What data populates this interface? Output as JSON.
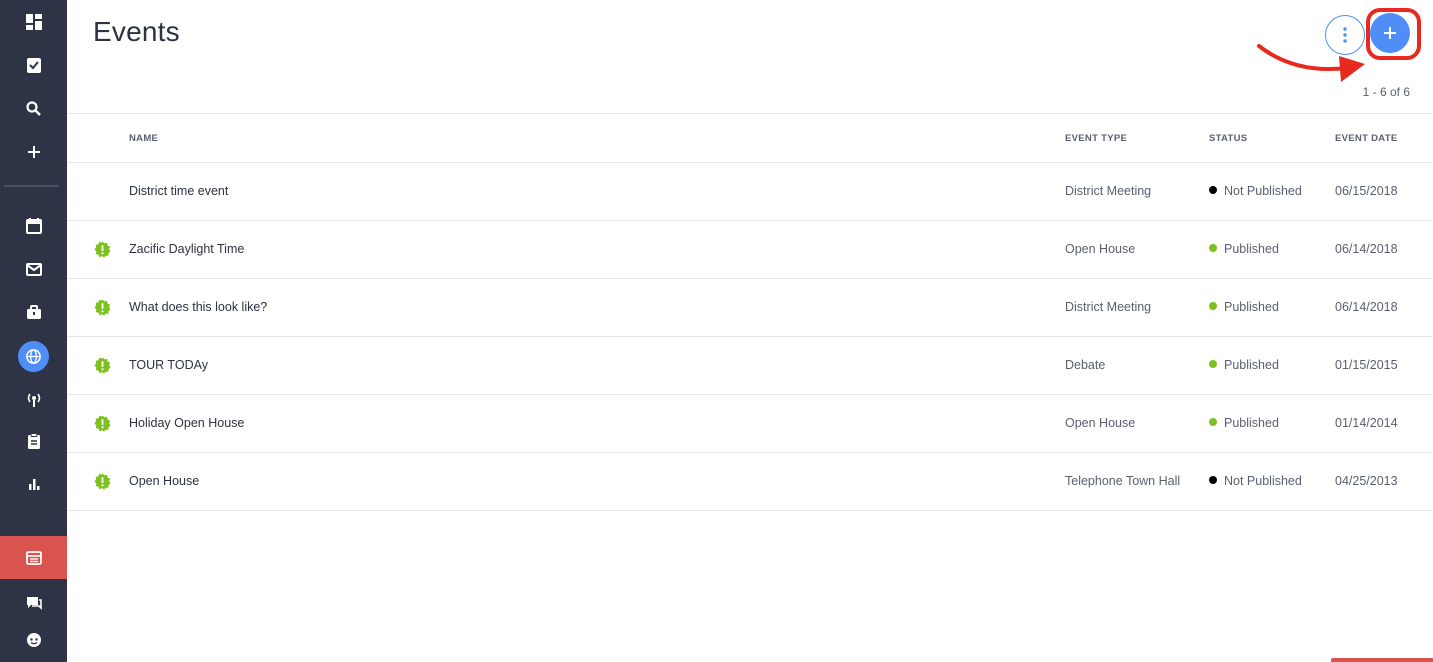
{
  "page": {
    "title": "Events",
    "count": "1 - 6 of 6"
  },
  "sidebar": {
    "items": [
      {
        "icon": "dashboard-icon"
      },
      {
        "icon": "clipboard-check-icon"
      },
      {
        "icon": "search-icon"
      },
      {
        "icon": "plus-icon"
      },
      {
        "icon": "calendar-icon"
      },
      {
        "icon": "mail-icon"
      },
      {
        "icon": "briefcase-icon"
      },
      {
        "icon": "globe-icon",
        "active": true
      },
      {
        "icon": "broadcast-icon"
      },
      {
        "icon": "clipboard-icon"
      },
      {
        "icon": "bar-chart-icon"
      },
      {
        "icon": "newspaper-icon",
        "highlight": true
      },
      {
        "icon": "chat-icon"
      },
      {
        "icon": "support-icon"
      }
    ]
  },
  "table": {
    "headers": {
      "name": "NAME",
      "type": "EVENT TYPE",
      "status": "STATUS",
      "date": "EVENT DATE"
    },
    "rows": [
      {
        "warning": false,
        "name": "District time event",
        "type": "District Meeting",
        "status": "Not Published",
        "status_color": "#000000",
        "date": "06/15/2018"
      },
      {
        "warning": true,
        "name": "Zacific Daylight Time",
        "type": "Open House",
        "status": "Published",
        "status_color": "#7cc11f",
        "date": "06/14/2018"
      },
      {
        "warning": true,
        "name": "What does this look like?",
        "type": "District Meeting",
        "status": "Published",
        "status_color": "#7cc11f",
        "date": "06/14/2018"
      },
      {
        "warning": true,
        "name": "TOUR TODAy",
        "type": "Debate",
        "status": "Published",
        "status_color": "#7cc11f",
        "date": "01/15/2015"
      },
      {
        "warning": true,
        "name": "Holiday Open House",
        "type": "Open House",
        "status": "Published",
        "status_color": "#7cc11f",
        "date": "01/14/2014"
      },
      {
        "warning": true,
        "name": "Open House",
        "type": "Telephone Town Hall",
        "status": "Not Published",
        "status_color": "#000000",
        "date": "04/25/2013"
      }
    ]
  },
  "colors": {
    "sidebar_bg": "#2e3346",
    "accent": "#4f8ef7",
    "warning": "#7cc11f",
    "highlight_red": "#d9534f",
    "annotation_red": "#e8291d"
  }
}
